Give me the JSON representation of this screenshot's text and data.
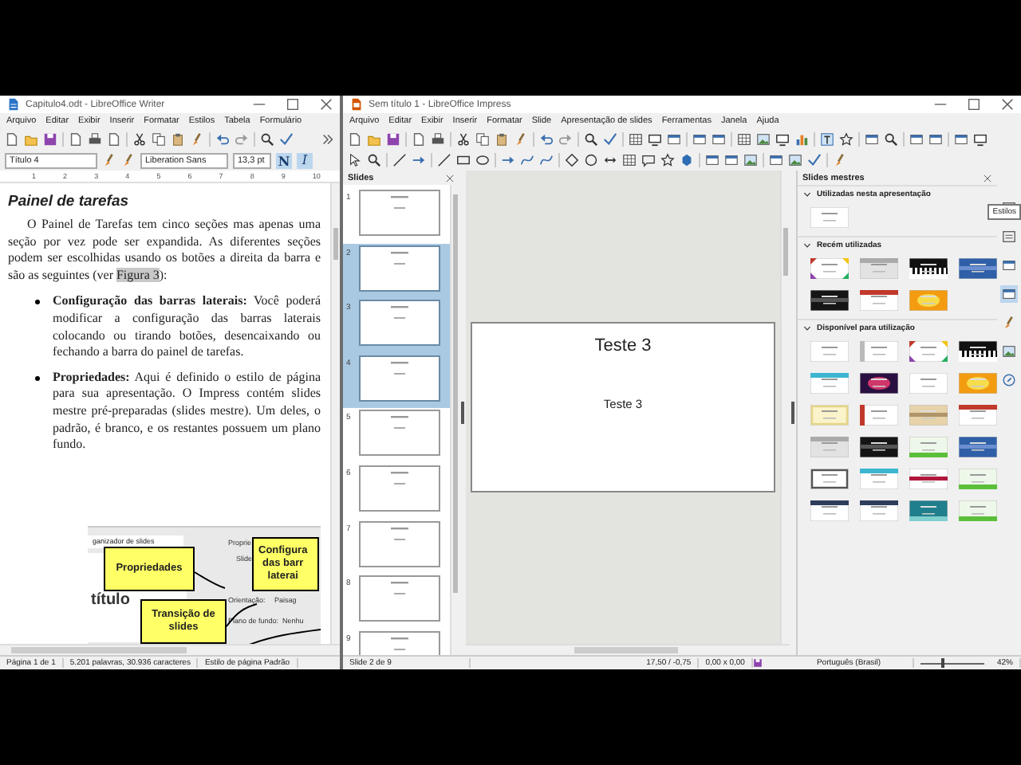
{
  "writer": {
    "title": "Capitulo4.odt - LibreOffice Writer",
    "menu": [
      "Arquivo",
      "Editar",
      "Exibir",
      "Inserir",
      "Formatar",
      "Estilos",
      "Tabela",
      "Formulário"
    ],
    "paragraph_style": "Título 4",
    "font_name": "Liberation Sans",
    "font_size": "13,3 pt",
    "format_buttons": [
      {
        "label": "N",
        "selected": true
      },
      {
        "label": "I",
        "selected": true
      }
    ],
    "ruler": [
      "1",
      "2",
      "3",
      "4",
      "5",
      "6",
      "7",
      "8",
      "9",
      "10"
    ],
    "heading": "Painel de tarefas",
    "paragraph": {
      "before": "O Painel de Tarefas tem cinco seções mas apenas uma seção por vez pode ser expandida. As diferentes seções podem ser escolhidas usando os botões a direita da barra e são as seguintes (ver ",
      "reference": "Figura 3",
      "after": "):"
    },
    "bullets": [
      "**Configuração das barras laterais:** Você poderá modificar a configuração das barras laterais colocando ou tirando botões, desencaixando ou fechando a barra do painel de tarefas.",
      "**Propriedades:** Aqui é definido o estilo de página para sua apresentação. O Impress contém slides mestre pré-preparadas (slides mestre). Um deles, o padrão, é branco, e os restantes possuem um plano fundo."
    ],
    "figure": {
      "panel_title": "ganizador de slides",
      "slide_title": "título",
      "properties_title": "Proprie",
      "section": "Slide",
      "orientation_label": "Orientação:",
      "orientation_value": "Paisag",
      "background_label": "Plano de fundo:",
      "background_value": "Nenhu",
      "callouts": [
        {
          "text": "Propriedades",
          "kind": "left"
        },
        {
          "text": "Configura\ndas barr\nlaterai",
          "kind": "right"
        },
        {
          "text": "Transição de\nslides",
          "kind": "bottom"
        }
      ]
    },
    "status_bar": [
      "Página 1 de 1",
      "5.201 palavras, 30.936 caracteres",
      "Estilo de página Padrão"
    ]
  },
  "impress": {
    "title": "Sem título 1 - LibreOffice Impress",
    "menu": [
      "Arquivo",
      "Editar",
      "Exibir",
      "Inserir",
      "Formatar",
      "Slide",
      "Apresentação de slides",
      "Ferramentas",
      "Janela",
      "Ajuda"
    ],
    "slides_panel": {
      "title": "Slides",
      "slides": [
        {
          "number": "1",
          "selected": false
        },
        {
          "number": "2",
          "selected": true
        },
        {
          "number": "3",
          "selected": true
        },
        {
          "number": "4",
          "selected": true
        },
        {
          "number": "5",
          "selected": false
        },
        {
          "number": "6",
          "selected": false
        },
        {
          "number": "7",
          "selected": false
        },
        {
          "number": "8",
          "selected": false
        },
        {
          "number": "9",
          "selected": false
        }
      ]
    },
    "slide": {
      "title": "Teste 3",
      "body": "Teste 3"
    },
    "master_slides": {
      "title": "Slides mestres",
      "sections": [
        {
          "title": "Utilizadas nesta apresentação",
          "expanded": true,
          "templates": [
            {
              "kind": "white"
            }
          ]
        },
        {
          "title": "Recém utilizadas",
          "expanded": true,
          "templates": [
            {
              "kind": "corners"
            },
            {
              "kind": "gray"
            },
            {
              "kind": "piano"
            },
            {
              "kind": "blue"
            },
            {
              "kind": "dark"
            },
            {
              "kind": "red"
            },
            {
              "kind": "orange"
            }
          ]
        },
        {
          "title": "Disponível para utilização",
          "expanded": true,
          "templates": [
            {
              "kind": "white"
            },
            {
              "kind": "notebook"
            },
            {
              "kind": "corners"
            },
            {
              "kind": "piano"
            },
            {
              "kind": "cyan"
            },
            {
              "kind": "purple"
            },
            {
              "kind": "white"
            },
            {
              "kind": "orange"
            },
            {
              "kind": "cream"
            },
            {
              "kind": "redleft"
            },
            {
              "kind": "beige"
            },
            {
              "kind": "red"
            },
            {
              "kind": "gray"
            },
            {
              "kind": "dark"
            },
            {
              "kind": "green"
            },
            {
              "kind": "blue"
            },
            {
              "kind": "frame"
            },
            {
              "kind": "cyan"
            },
            {
              "kind": "crimson"
            },
            {
              "kind": "green"
            },
            {
              "kind": "navy"
            },
            {
              "kind": "navy"
            },
            {
              "kind": "teal"
            },
            {
              "kind": "green"
            }
          ]
        }
      ]
    },
    "tooltip": "Estilos",
    "status_bar": {
      "slide": "Slide 2 de 9",
      "position": "17,50 / -0,75",
      "size": "0,00 x 0,00",
      "language": "Português (Brasil)",
      "zoom": {
        "level": 0.35
      },
      "zoom_percent": "42%"
    }
  }
}
